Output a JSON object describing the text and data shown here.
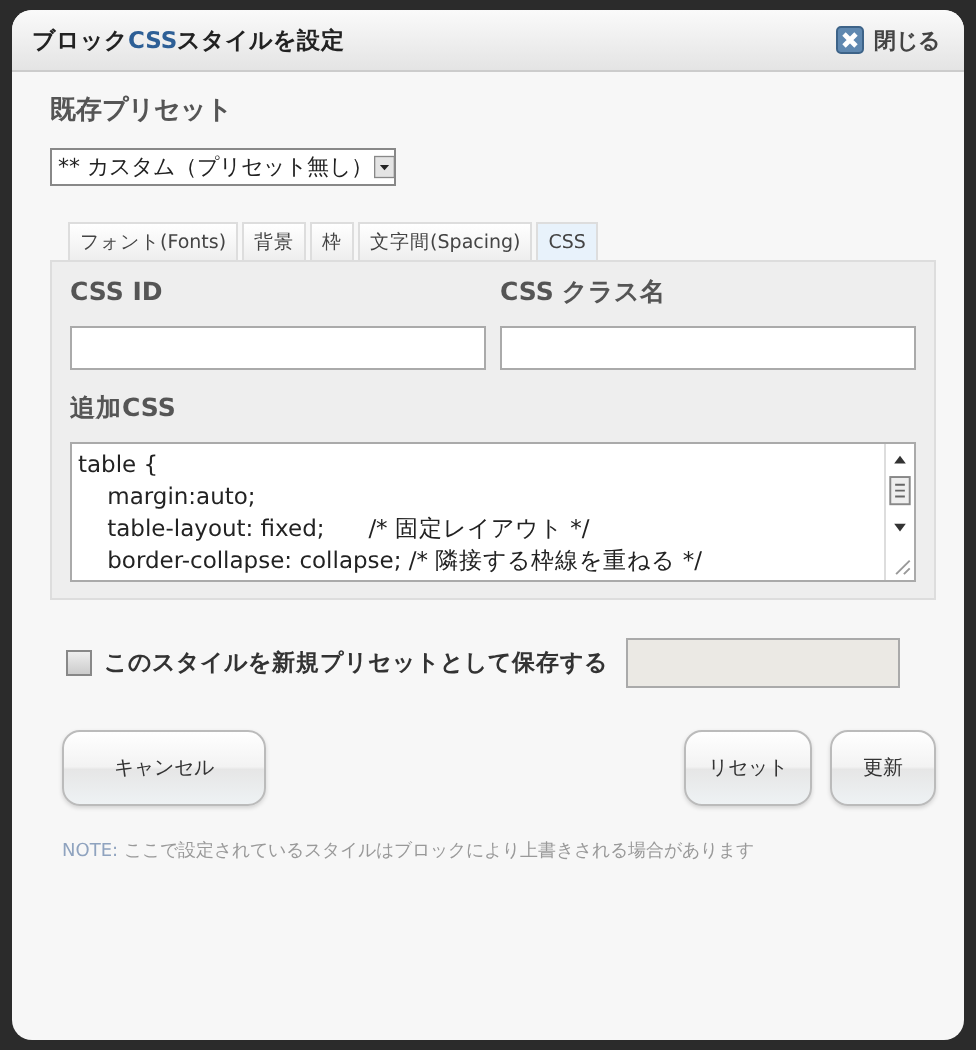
{
  "window": {
    "title_parts": [
      {
        "text": "ブロック",
        "accent": false
      },
      {
        "text": "CSS",
        "accent": true
      },
      {
        "text": "スタイルを設定",
        "accent": false
      }
    ],
    "close_label": "閉じる"
  },
  "preset": {
    "label": "既存プリセット",
    "value": "** カスタム（プリセット無し）"
  },
  "tabs": [
    {
      "label": "フォント(Fonts)",
      "selected": false
    },
    {
      "label": "背景",
      "selected": false
    },
    {
      "label": "枠",
      "selected": false
    },
    {
      "label": "文字間(Spacing)",
      "selected": false
    },
    {
      "label": "CSS",
      "selected": true
    }
  ],
  "css_id": {
    "label": "CSS ID"
  },
  "css_class": {
    "label": "CSS クラス名"
  },
  "custom_css": {
    "label": "追加CSS",
    "value": "table {\n    margin:auto;\n    table-layout: fixed;      /* 固定レイアウト */\n    border-collapse: collapse; /* 隣接する枠線を重ねる */"
  },
  "save_preset": {
    "label": "このスタイルを新規プリセットとして保存する",
    "checked": false
  },
  "buttons": {
    "cancel": "キャンセル",
    "reset": "リセット",
    "update": "更新"
  },
  "note": {
    "label": "NOTE:",
    "text": "ここで設定されているスタイルはブロックにより上書きされる場合があります"
  }
}
